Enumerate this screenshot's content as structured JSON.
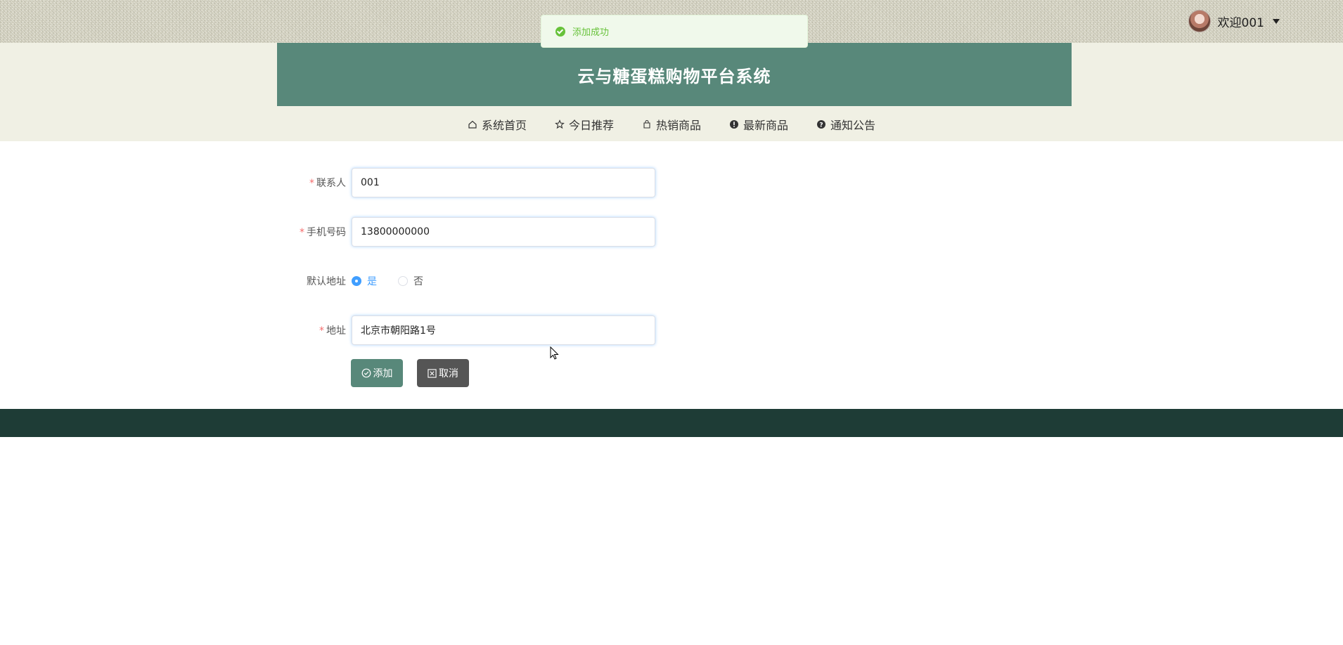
{
  "toast": {
    "message": "添加成功",
    "type": "success",
    "color": "#67c23a"
  },
  "user": {
    "welcome": "欢迎001"
  },
  "header": {
    "title": "云与糖蛋糕购物平台系统",
    "brand_color": "#58887a"
  },
  "nav": {
    "items": [
      {
        "label": "系统首页",
        "icon": "home-icon"
      },
      {
        "label": "今日推荐",
        "icon": "star-icon"
      },
      {
        "label": "热销商品",
        "icon": "bag-icon"
      },
      {
        "label": "最新商品",
        "icon": "alert-icon"
      },
      {
        "label": "通知公告",
        "icon": "question-icon"
      }
    ]
  },
  "form": {
    "contact": {
      "label": "联系人",
      "required": "*",
      "value": "001"
    },
    "phone": {
      "label": "手机号码",
      "required": "*",
      "value": "13800000000"
    },
    "default_address": {
      "label": "默认地址",
      "options": [
        {
          "label": "是"
        },
        {
          "label": "否"
        }
      ],
      "selected": "是"
    },
    "address": {
      "label": "地址",
      "required": "*",
      "value": "北京市朝阳路1号"
    }
  },
  "buttons": {
    "add": "添加",
    "cancel": "取消"
  },
  "colors": {
    "footer": "#1e3c36",
    "cancel": "#555555",
    "radio_active": "#409eff"
  }
}
